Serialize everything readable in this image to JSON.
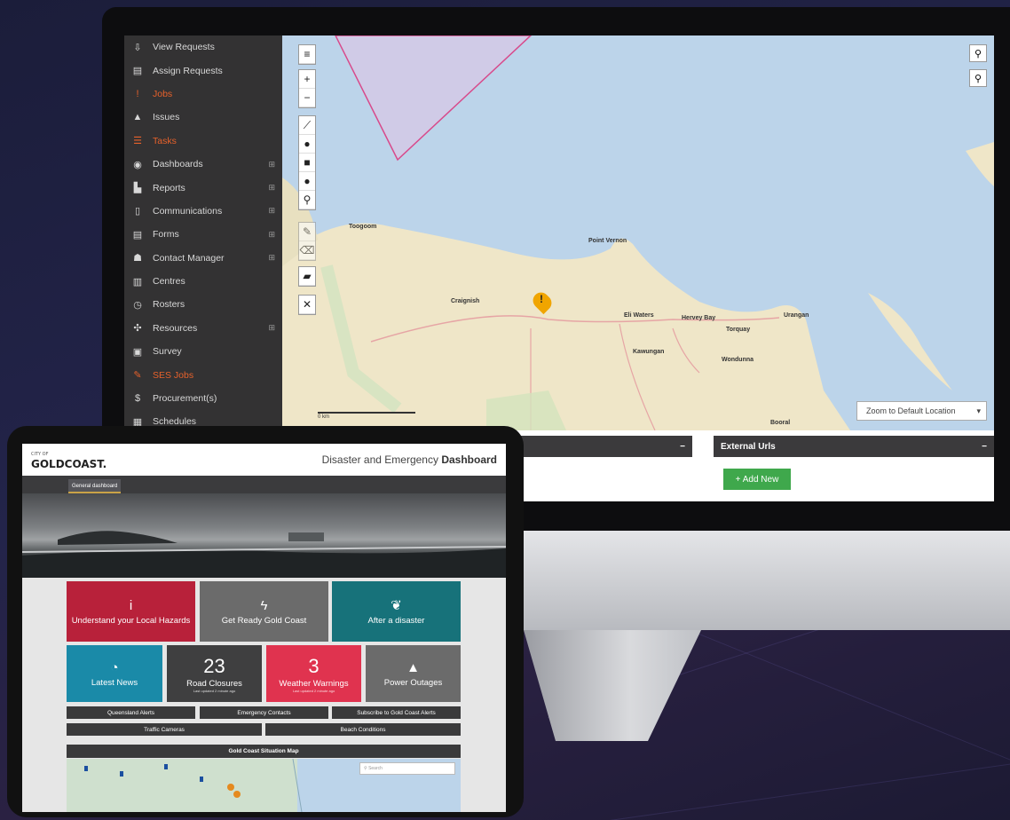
{
  "desktop": {
    "sidebar": {
      "items": [
        {
          "icon": "pin-icon",
          "glyph": "⇩",
          "label": "View Requests",
          "active": false,
          "expandable": false
        },
        {
          "icon": "assign-icon",
          "glyph": "▤",
          "label": "Assign Requests",
          "active": false,
          "expandable": false
        },
        {
          "icon": "exclamation-icon",
          "glyph": "!",
          "label": "Jobs",
          "active": true,
          "expandable": false
        },
        {
          "icon": "warning-icon",
          "glyph": "▲",
          "label": "Issues",
          "active": false,
          "expandable": false
        },
        {
          "icon": "tasks-icon",
          "glyph": "☰",
          "label": "Tasks",
          "active": true,
          "expandable": false
        },
        {
          "icon": "dashboard-icon",
          "glyph": "◉",
          "label": "Dashboards",
          "active": false,
          "expandable": true
        },
        {
          "icon": "reports-icon",
          "glyph": "▙",
          "label": "Reports",
          "active": false,
          "expandable": true
        },
        {
          "icon": "phone-icon",
          "glyph": "▯",
          "label": "Communications",
          "active": false,
          "expandable": true
        },
        {
          "icon": "forms-icon",
          "glyph": "▤",
          "label": "Forms",
          "active": false,
          "expandable": true
        },
        {
          "icon": "contacts-icon",
          "glyph": "☗",
          "label": "Contact Manager",
          "active": false,
          "expandable": true
        },
        {
          "icon": "building-icon",
          "glyph": "▥",
          "label": "Centres",
          "active": false,
          "expandable": false
        },
        {
          "icon": "clock-icon",
          "glyph": "◷",
          "label": "Rosters",
          "active": false,
          "expandable": false
        },
        {
          "icon": "resources-icon",
          "glyph": "✣",
          "label": "Resources",
          "active": false,
          "expandable": true
        },
        {
          "icon": "survey-icon",
          "glyph": "▣",
          "label": "Survey",
          "active": false,
          "expandable": false
        },
        {
          "icon": "wrench-icon",
          "glyph": "✎",
          "label": "SES Jobs",
          "active": true,
          "expandable": false
        },
        {
          "icon": "dollar-icon",
          "glyph": "$",
          "label": "Procurement(s)",
          "active": false,
          "expandable": false
        },
        {
          "icon": "calendar-icon",
          "glyph": "▦",
          "label": "Schedules",
          "active": false,
          "expandable": false
        }
      ]
    },
    "map": {
      "labels": [
        "Toogoom",
        "Point Vernon",
        "Craignish",
        "Urangan",
        "Eli Waters",
        "Hervey Bay",
        "Torquay",
        "Kawungan",
        "Wondunna",
        "Booral"
      ],
      "zoom_select": "Zoom to Default Location",
      "scale_label": "0 km"
    },
    "panels": {
      "external_urls_title": "External Urls",
      "add_new_label": "+ Add New",
      "collapse_glyph": "−"
    }
  },
  "tablet": {
    "logo_top": "CITY OF",
    "logo": "GOLDCOAST.",
    "title_light": "Disaster and Emergency",
    "title_bold": "Dashboard",
    "nav_tab": "General dashboard",
    "tiles": [
      {
        "id": "hazards",
        "icon": "info-icon",
        "glyph": "i",
        "label": "Understand your Local Hazards",
        "color": "#b8213a"
      },
      {
        "id": "get-ready",
        "icon": "lightning-icon",
        "glyph": "ϟ",
        "label": "Get Ready Gold Coast",
        "color": "#6b6b6b"
      },
      {
        "id": "after",
        "icon": "leaf-icon",
        "glyph": "❦",
        "label": "After a disaster",
        "color": "#17727a"
      }
    ],
    "stat_tiles": [
      {
        "id": "news",
        "icon": "rss-icon",
        "glyph": "◔",
        "number": "",
        "label": "Latest News",
        "sub": "",
        "color": "#1a8aa8"
      },
      {
        "id": "roads",
        "icon": "",
        "glyph": "",
        "number": "23",
        "label": "Road Closures",
        "sub": "Last updated 2 minute ago",
        "color": "#3f3f40"
      },
      {
        "id": "weather",
        "icon": "",
        "glyph": "",
        "number": "3",
        "label": "Weather Warnings",
        "sub": "Last updated 2 minute ago",
        "color": "#e0334f"
      },
      {
        "id": "power",
        "icon": "warning-icon",
        "glyph": "▲",
        "number": "",
        "label": "Power Outages",
        "sub": "",
        "color": "#6b6b6b"
      }
    ],
    "links_row1": [
      "Queensland Alerts",
      "Emergency Contacts",
      "Subscribe to Gold Coast Alerts"
    ],
    "links_row2": [
      "Traffic Cameras",
      "Beach Conditions"
    ],
    "map_title": "Gold Coast Situation Map",
    "map_search_placeholder": "Search"
  }
}
